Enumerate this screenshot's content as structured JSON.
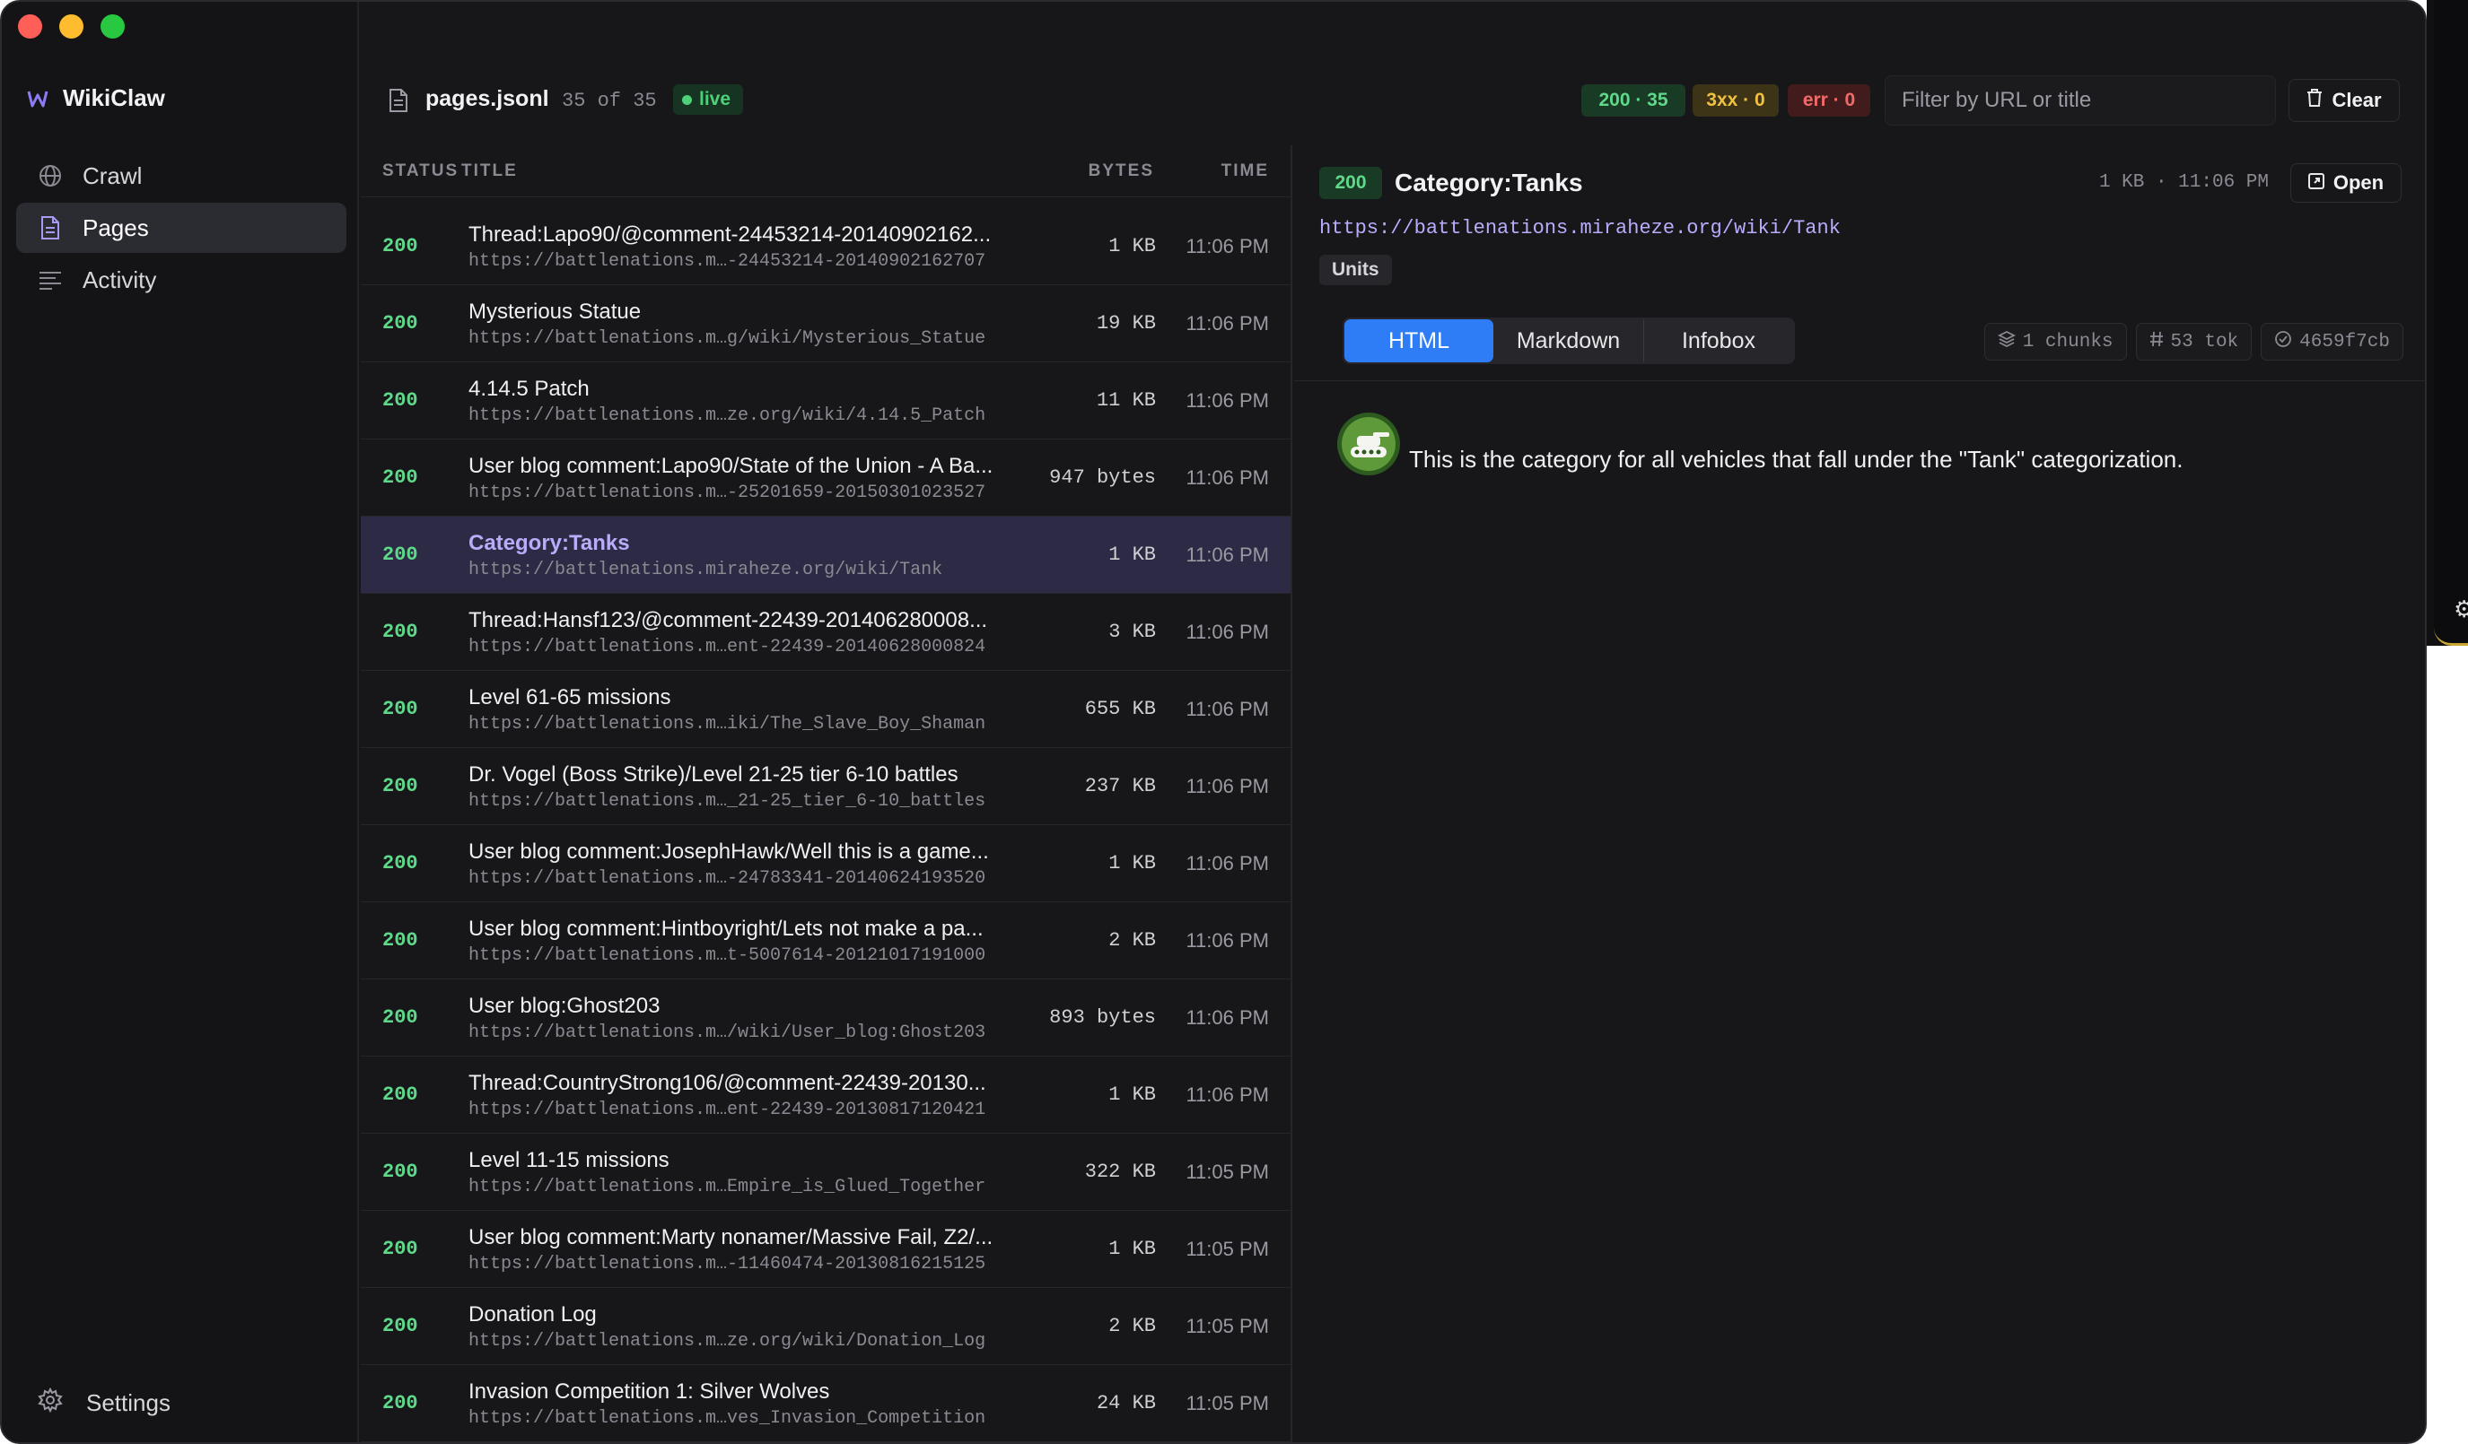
{
  "app": {
    "name": "WikiClaw"
  },
  "sidebar": {
    "items": [
      {
        "label": "Crawl",
        "icon": "globe-icon"
      },
      {
        "label": "Pages",
        "icon": "document-icon"
      },
      {
        "label": "Activity",
        "icon": "activity-lines-icon"
      }
    ],
    "active": "Pages",
    "settings_label": "Settings"
  },
  "topbar": {
    "file_name": "pages.jsonl",
    "count": "35 of 35",
    "live_label": "live",
    "stats": {
      "ok": "200 · 35",
      "redirect": "3xx · 0",
      "error": "err · 0"
    },
    "filter_placeholder": "Filter by URL or title",
    "clear_label": "Clear"
  },
  "list": {
    "headers": {
      "status": "STATUS",
      "title": "TITLE",
      "bytes": "BYTES",
      "time": "TIME"
    },
    "rows": [
      {
        "status": "200",
        "title": "Thread:Lapo90/@comment-24453214-20140902162...",
        "url": "https://battlenations.m…-24453214-20140902162707",
        "bytes": "1 KB",
        "time": "11:06 PM"
      },
      {
        "status": "200",
        "title": "Mysterious Statue",
        "url": "https://battlenations.m…g/wiki/Mysterious_Statue",
        "bytes": "19 KB",
        "time": "11:06 PM"
      },
      {
        "status": "200",
        "title": "4.14.5 Patch",
        "url": "https://battlenations.m…ze.org/wiki/4.14.5_Patch",
        "bytes": "11 KB",
        "time": "11:06 PM"
      },
      {
        "status": "200",
        "title": "User blog comment:Lapo90/State of the Union - A Ba...",
        "url": "https://battlenations.m…-25201659-20150301023527",
        "bytes": "947 bytes",
        "time": "11:06 PM"
      },
      {
        "status": "200",
        "title": "Category:Tanks",
        "url": "https://battlenations.miraheze.org/wiki/Tank",
        "bytes": "1 KB",
        "time": "11:06 PM",
        "selected": true
      },
      {
        "status": "200",
        "title": "Thread:Hansf123/@comment-22439-201406280008...",
        "url": "https://battlenations.m…ent-22439-20140628000824",
        "bytes": "3 KB",
        "time": "11:06 PM"
      },
      {
        "status": "200",
        "title": "Level 61-65 missions",
        "url": "https://battlenations.m…iki/The_Slave_Boy_Shaman",
        "bytes": "655 KB",
        "time": "11:06 PM"
      },
      {
        "status": "200",
        "title": "Dr. Vogel (Boss Strike)/Level 21-25 tier 6-10 battles",
        "url": "https://battlenations.m…_21-25_tier_6-10_battles",
        "bytes": "237 KB",
        "time": "11:06 PM"
      },
      {
        "status": "200",
        "title": "User blog comment:JosephHawk/Well this is a game...",
        "url": "https://battlenations.m…-24783341-20140624193520",
        "bytes": "1 KB",
        "time": "11:06 PM"
      },
      {
        "status": "200",
        "title": "User blog comment:Hintboyright/Lets not make a pa...",
        "url": "https://battlenations.m…t-5007614-20121017191000",
        "bytes": "2 KB",
        "time": "11:06 PM"
      },
      {
        "status": "200",
        "title": "User blog:Ghost203",
        "url": "https://battlenations.m…/wiki/User_blog:Ghost203",
        "bytes": "893 bytes",
        "time": "11:06 PM"
      },
      {
        "status": "200",
        "title": "Thread:CountryStrong106/@comment-22439-20130...",
        "url": "https://battlenations.m…ent-22439-20130817120421",
        "bytes": "1 KB",
        "time": "11:06 PM"
      },
      {
        "status": "200",
        "title": "Level 11-15 missions",
        "url": "https://battlenations.m…Empire_is_Glued_Together",
        "bytes": "322 KB",
        "time": "11:05 PM"
      },
      {
        "status": "200",
        "title": "User blog comment:Marty nonamer/Massive Fail, Z2/...",
        "url": "https://battlenations.m…-11460474-20130816215125",
        "bytes": "1 KB",
        "time": "11:05 PM"
      },
      {
        "status": "200",
        "title": "Donation Log",
        "url": "https://battlenations.m…ze.org/wiki/Donation_Log",
        "bytes": "2 KB",
        "time": "11:05 PM"
      },
      {
        "status": "200",
        "title": "Invasion Competition 1: Silver Wolves",
        "url": "https://battlenations.m…ves_Invasion_Competition",
        "bytes": "24 KB",
        "time": "11:05 PM"
      }
    ]
  },
  "detail": {
    "status": "200",
    "title": "Category:Tanks",
    "meta": "1 KB · 11:06 PM",
    "open_label": "Open",
    "url": "https://battlenations.miraheze.org/wiki/Tank",
    "tag": "Units",
    "tabs": [
      "HTML",
      "Markdown",
      "Infobox"
    ],
    "active_tab": "HTML",
    "chips": {
      "chunks": "1 chunks",
      "tokens": "53 tok",
      "hash": "4659f7cb"
    },
    "content_text": "This is the category for all vehicles that fall under the \"Tank\" categorization."
  },
  "colors": {
    "accent": "#2f7df6",
    "ok": "#5fd88a",
    "warn": "#f0c040",
    "error": "#f06a6a",
    "selection": "#2c2a44",
    "link": "#b9adfb"
  }
}
